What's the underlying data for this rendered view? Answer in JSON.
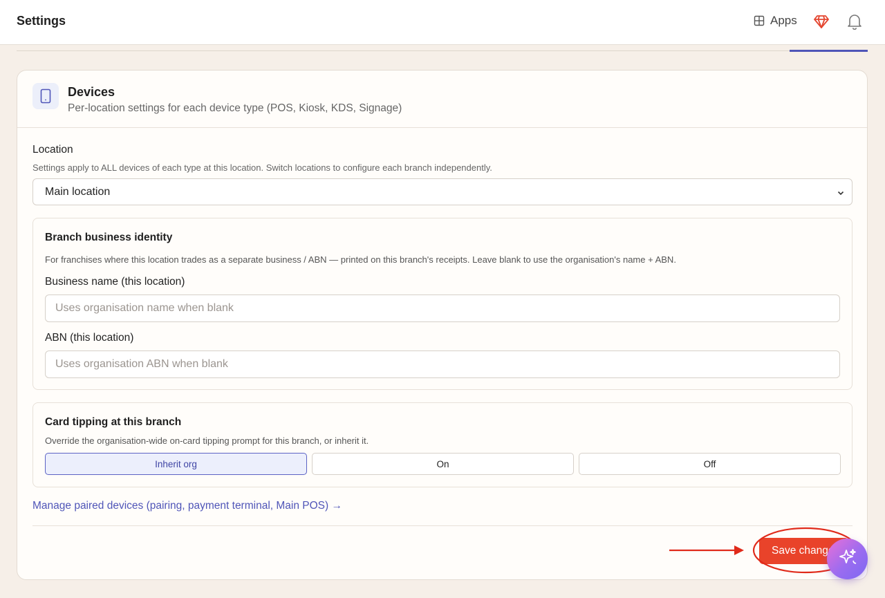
{
  "header": {
    "title": "Settings",
    "apps_label": "Apps"
  },
  "card": {
    "title": "Devices",
    "subtitle": "Per-location settings for each device type (POS, Kiosk, KDS, Signage)"
  },
  "location": {
    "label": "Location",
    "help": "Settings apply to ALL devices of each type at this location. Switch locations to configure each branch independently.",
    "selected": "Main location"
  },
  "identity": {
    "title": "Branch business identity",
    "help": "For franchises where this location trades as a separate business / ABN — printed on this branch's receipts. Leave blank to use the organisation's name + ABN.",
    "business_name_label": "Business name (this location)",
    "business_name_value": "",
    "business_name_placeholder": "Uses organisation name when blank",
    "abn_label": "ABN (this location)",
    "abn_value": "",
    "abn_placeholder": "Uses organisation ABN when blank"
  },
  "tipping": {
    "title": "Card tipping at this branch",
    "help": "Override the organisation-wide on-card tipping prompt for this branch, or inherit it.",
    "options": [
      "Inherit org",
      "On",
      "Off"
    ],
    "selected": "Inherit org"
  },
  "manage_link": "Manage paired devices (pairing, payment terminal, Main POS) →",
  "save_label": "Save changes",
  "colors": {
    "accent": "#4f55b8",
    "save": "#e9432a",
    "annotation": "#e02a1a",
    "background": "#f6efe8"
  },
  "icons": {
    "apps": "grid-icon",
    "gem": "gem-icon",
    "bell": "bell-icon",
    "device": "tablet-icon",
    "select": "chevron-down-icon",
    "assistant": "sparkle-icon"
  }
}
